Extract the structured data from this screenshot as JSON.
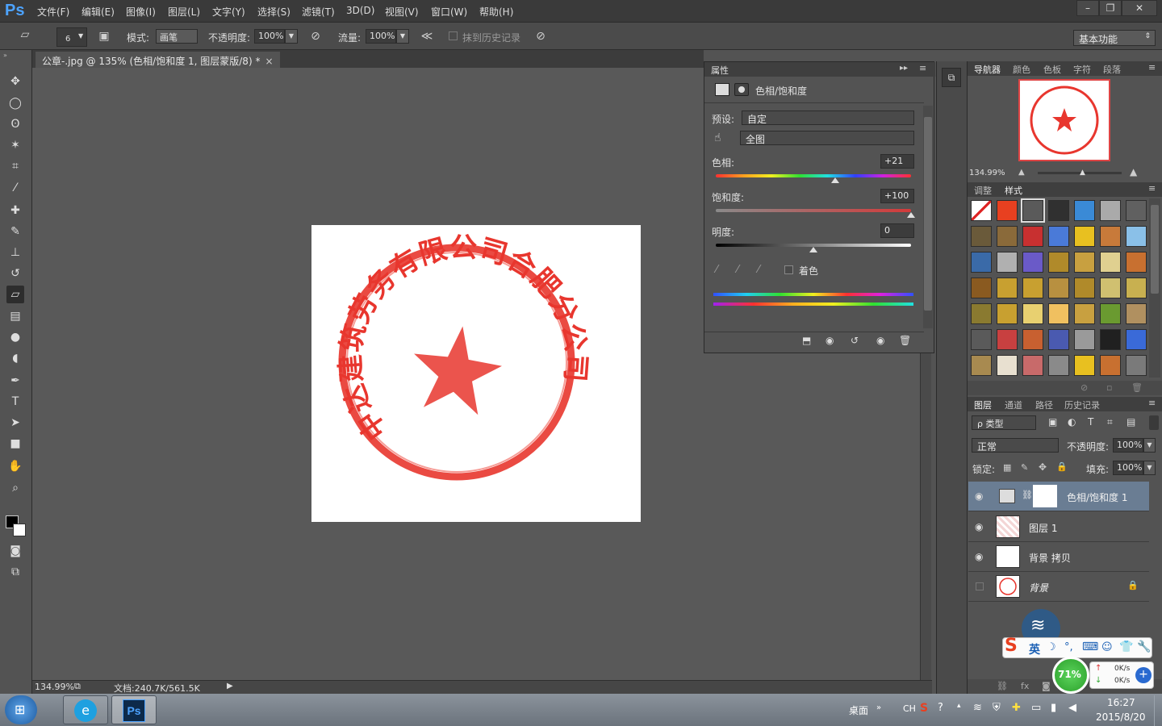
{
  "app": {
    "logo": "Ps",
    "menu": [
      "文件(F)",
      "编辑(E)",
      "图像(I)",
      "图层(L)",
      "文字(Y)",
      "选择(S)",
      "滤镜(T)",
      "3D(D)",
      "视图(V)",
      "窗口(W)",
      "帮助(H)"
    ],
    "window_controls": [
      "–",
      "❐",
      "✕"
    ]
  },
  "options": {
    "brush_size": "6",
    "mode_label": "模式:",
    "mode_value": "画笔",
    "opacity_label": "不透明度:",
    "opacity_value": "100%",
    "flow_label": "流量:",
    "flow_value": "100%",
    "history_label": "抹到历史记录",
    "workspace": "基本功能"
  },
  "document": {
    "tab_title": "公章-.jpg @ 135% (色相/饱和度 1, 图层蒙版/8) *",
    "close": "×",
    "stamp_text": "中达建筑劳务有限公司合肥分公司",
    "zoom": "134.99%",
    "doc_info": "文档:240.7K/561.5K"
  },
  "properties": {
    "panel_title": "属性",
    "header": "色相/饱和度",
    "preset_label": "预设:",
    "preset_value": "自定",
    "range_value": "全图",
    "hue_label": "色相:",
    "hue_value": "+21",
    "hue_position": 0.61,
    "saturation_label": "饱和度:",
    "saturation_value": "+100",
    "saturation_position": 1.0,
    "lightness_label": "明度:",
    "lightness_value": "0",
    "lightness_position": 0.5,
    "colorize_label": "着色"
  },
  "navigator": {
    "tabs": [
      "导航器",
      "颜色",
      "色板",
      "字符",
      "段落"
    ],
    "zoom": "134.99%"
  },
  "styles": {
    "tabs": [
      "调整",
      "样式"
    ],
    "swatch_colors": [
      "#ffffff",
      "#e84020",
      "#5a5a5a",
      "#303030",
      "#3a8ad6",
      "#aaaaaa",
      "#606060",
      "#6a5a3a",
      "#8a6a3a",
      "#c83030",
      "#4a7ad8",
      "#e8c020",
      "#c87a3a",
      "#8ac0e8",
      "#3a6aa8",
      "#b0b0b0",
      "#6a5ac8",
      "#b08a2a",
      "#c8a040",
      "#e0d090",
      "#c87030",
      "#8a5a20",
      "#c8a030",
      "#c8a030",
      "#b89040",
      "#b08a2a",
      "#d0c070",
      "#c8b050",
      "#8a7a30",
      "#c8a030",
      "#e8d070",
      "#f0c060",
      "#c8a040",
      "#6a9a30",
      "#b09060",
      "#5a5a5a",
      "#c84040",
      "#c86030",
      "#4a5ab0",
      "#9a9a9a",
      "#202020",
      "#3a6ad8",
      "#a88a50",
      "#e8e0d0",
      "#c86a6a",
      "#8a8a8a",
      "#e8c020",
      "#c87030",
      "#7a7a7a"
    ]
  },
  "layers": {
    "tabs": [
      "图层",
      "通道",
      "路径",
      "历史记录"
    ],
    "filter": "ρ 类型",
    "blend_mode": "正常",
    "opacity_label": "不透明度:",
    "opacity_value": "100%",
    "lock_label": "锁定:",
    "fill_label": "填充:",
    "fill_value": "100%",
    "items": [
      {
        "name": "色相/饱和度 1"
      },
      {
        "name": "图层 1"
      },
      {
        "name": "背景 拷贝"
      },
      {
        "name": "背景"
      }
    ]
  },
  "ime": {
    "label": "英",
    "cpu": "71%",
    "up_speed": "0K/s",
    "down_speed": "0K/s"
  },
  "taskbar": {
    "desktop": "桌面",
    "lang": "CH",
    "time": "16:27",
    "date": "2015/8/20"
  }
}
